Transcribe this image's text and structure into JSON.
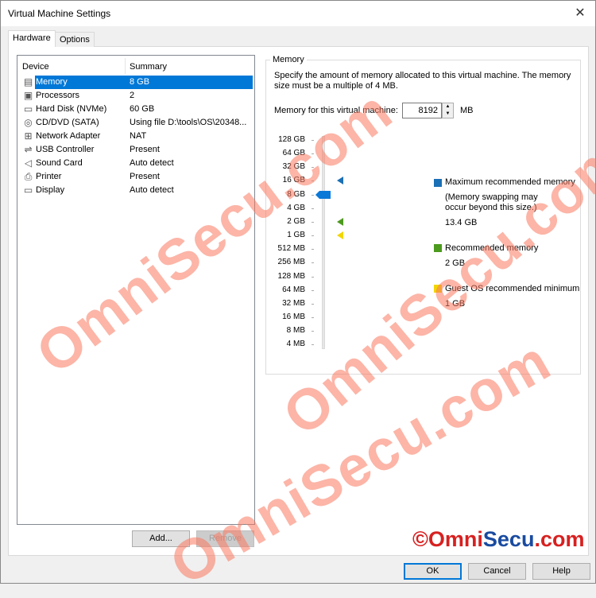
{
  "window": {
    "title": "Virtual Machine Settings",
    "close_icon": "close-icon"
  },
  "tabs": [
    {
      "label": "Hardware",
      "active": true
    },
    {
      "label": "Options",
      "active": false
    }
  ],
  "device_list": {
    "headers": {
      "device": "Device",
      "summary": "Summary"
    },
    "items": [
      {
        "icon": "memory-icon",
        "glyph": "▤",
        "name": "Memory",
        "summary": "8 GB",
        "selected": true
      },
      {
        "icon": "processor-icon",
        "glyph": "▣",
        "name": "Processors",
        "summary": "2"
      },
      {
        "icon": "hard-disk-icon",
        "glyph": "▭",
        "name": "Hard Disk (NVMe)",
        "summary": "60 GB"
      },
      {
        "icon": "cd-dvd-icon",
        "glyph": "◎",
        "name": "CD/DVD (SATA)",
        "summary": "Using file D:\\tools\\OS\\20348..."
      },
      {
        "icon": "network-adapter-icon",
        "glyph": "⊞",
        "name": "Network Adapter",
        "summary": "NAT"
      },
      {
        "icon": "usb-icon",
        "glyph": "⇌",
        "name": "USB Controller",
        "summary": "Present"
      },
      {
        "icon": "sound-icon",
        "glyph": "◁",
        "name": "Sound Card",
        "summary": "Auto detect"
      },
      {
        "icon": "printer-icon",
        "glyph": "⎙",
        "name": "Printer",
        "summary": "Present"
      },
      {
        "icon": "display-icon",
        "glyph": "▭",
        "name": "Display",
        "summary": "Auto detect"
      }
    ]
  },
  "list_buttons": {
    "add": "Add...",
    "remove": "Remove"
  },
  "memory": {
    "group_label": "Memory",
    "description": "Specify the amount of memory allocated to this virtual machine. The memory size must be a multiple of 4 MB.",
    "field_label": "Memory for this virtual machine:",
    "value": "8192",
    "unit": "MB",
    "scale": [
      "128 GB",
      "64 GB",
      "32 GB",
      "16 GB",
      "8 GB",
      "4 GB",
      "2 GB",
      "1 GB",
      "512 MB",
      "256 MB",
      "128 MB",
      "64 MB",
      "32 MB",
      "16 MB",
      "8 MB",
      "4 MB"
    ],
    "slider_value": "8 GB",
    "legend": {
      "max": {
        "label": "Maximum recommended memory",
        "note": "(Memory swapping may occur beyond this size.)",
        "value": "13.4 GB",
        "color": "#1a6fb5",
        "marker_at": "16 GB"
      },
      "rec": {
        "label": "Recommended memory",
        "value": "2 GB",
        "color": "#4c9a1e",
        "marker_at": "2 GB"
      },
      "min": {
        "label": "Guest OS recommended minimum",
        "value": "1 GB",
        "color": "#f2d600",
        "marker_at": "1 GB"
      }
    }
  },
  "footer": {
    "ok": "OK",
    "cancel": "Cancel",
    "help": "Help"
  },
  "watermark": {
    "text": "OmniSecu.com",
    "copyright_a": "©Omni",
    "copyright_b": "Secu",
    "copyright_c": ".com"
  }
}
